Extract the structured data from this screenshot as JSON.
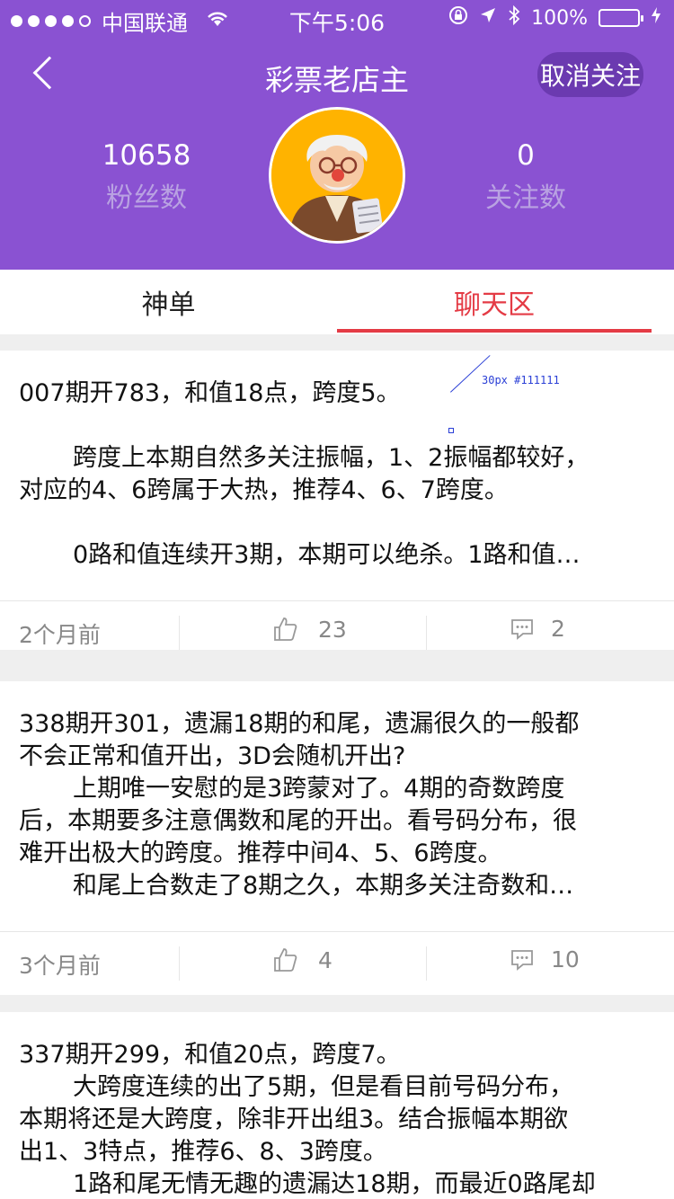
{
  "status_bar": {
    "carrier": "中国联通",
    "time": "下午5:06",
    "battery": "100%"
  },
  "header": {
    "title": "彩票老店主",
    "unfollow_label": "取消关注",
    "fans_count": "10658",
    "fans_label": "粉丝数",
    "follow_count": "0",
    "follow_label": "关注数",
    "bg_color": "#8a52d2"
  },
  "tabs": [
    {
      "label": "神单",
      "active": false
    },
    {
      "label": "聊天区",
      "active": true
    }
  ],
  "annotation": "30px #111111",
  "posts": [
    {
      "lines": [
        "007期开783，和值18点，跨度5。",
        "",
        "跨度上本期自然多关注振幅，1、2振幅都较好，",
        "对应的4、6跨属于大热，推荐4、6、7跨度。",
        "",
        "0路和值连续开3期，本期可以绝杀。1路和值…"
      ],
      "time": "2个月前",
      "likes": "23",
      "comments": "2"
    },
    {
      "lines": [
        "338期开301，遗漏18期的和尾，遗漏很久的一般都",
        "不会正常和值开出，3D会随机开出?",
        "上期唯一安慰的是3跨蒙对了。4期的奇数跨度",
        "后，本期要多注意偶数和尾的开出。看号码分布，很",
        "难开出极大的跨度。推荐中间4、5、6跨度。",
        "和尾上合数走了8期之久，本期多关注奇数和…"
      ],
      "time": "3个月前",
      "likes": "4",
      "comments": "10"
    },
    {
      "lines": [
        "337期开299，和值20点，跨度7。",
        "大跨度连续的出了5期，但是看目前号码分布，",
        "本期将还是大跨度，除非开出组3。结合振幅本期欲",
        "出1、3特点，推荐6、8、3跨度。",
        "1路和尾无情无趣的遗漏达18期，而最近0路尾却"
      ]
    }
  ]
}
